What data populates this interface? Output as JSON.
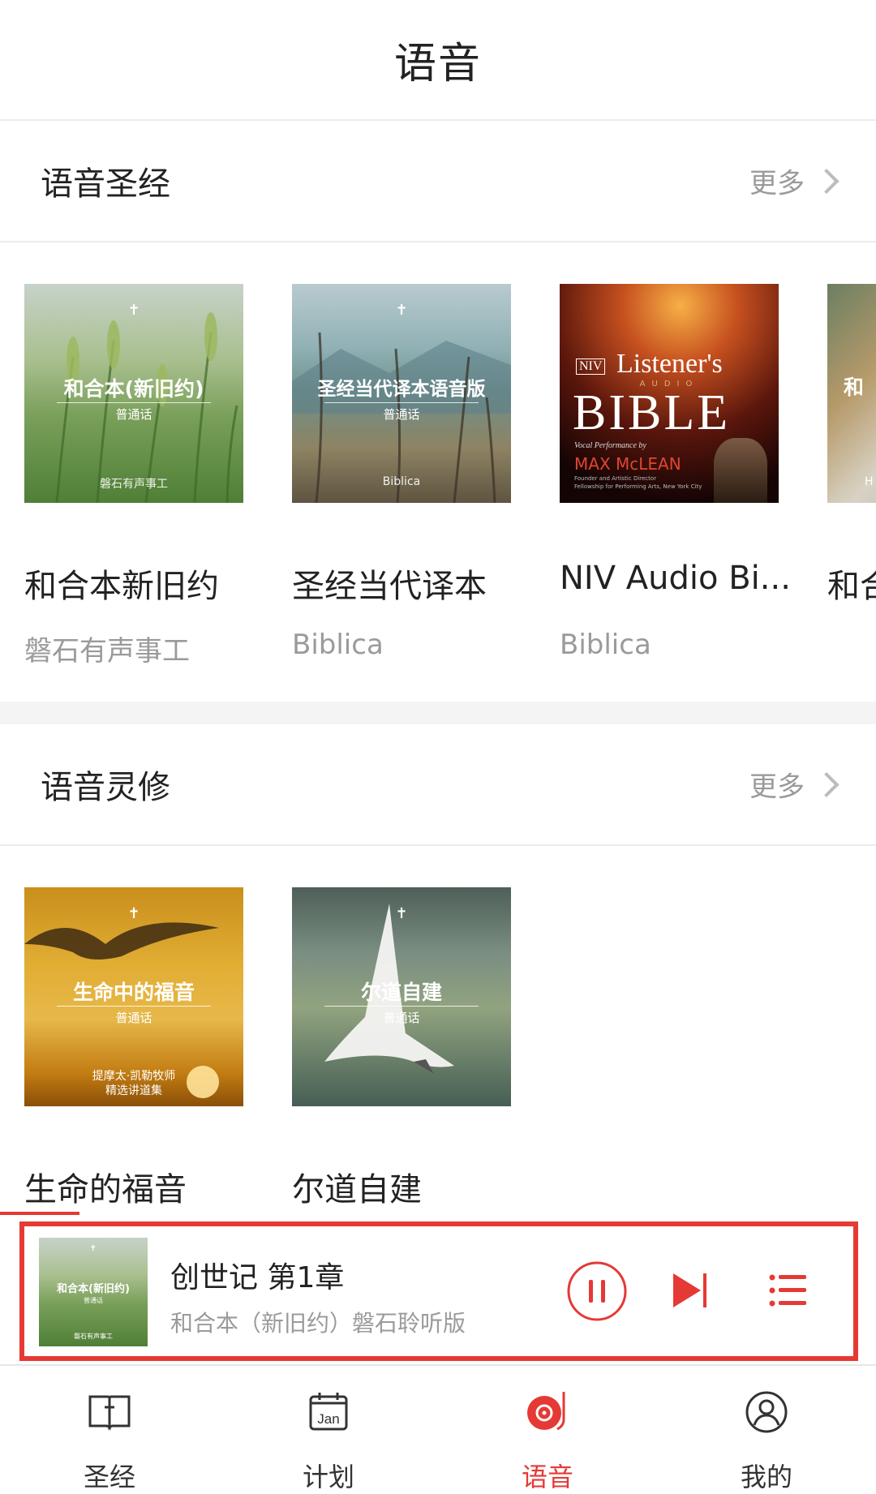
{
  "header": {
    "title": "语音"
  },
  "audio_bible": {
    "title": "语音圣经",
    "more_label": "更多",
    "items": [
      {
        "name": "和合本新旧约",
        "publisher": "磐石有声事工",
        "cover": {
          "title": "和合本(新旧约)",
          "dialect": "普通话",
          "footer": "磐石有声事工"
        }
      },
      {
        "name": "圣经当代译本",
        "publisher": "Biblica",
        "cover": {
          "title": "圣经当代译本语音版",
          "dialect": "普通话",
          "footer": "Biblica"
        }
      },
      {
        "name": "NIV Audio Bi...",
        "publisher": "Biblica",
        "cover": {
          "badge": "NIV",
          "title_top": "Listener's",
          "audio": "AUDIO",
          "title_main": "BIBLE",
          "vocal": "Vocal Performance by",
          "narrator": "MAX McLEAN",
          "credit1": "Founder and Artistic Director",
          "credit2": "Fellowship for Performing Arts, New York City"
        }
      },
      {
        "name": "和合",
        "publisher": "",
        "cover": {
          "title": "和",
          "footer": "H"
        }
      }
    ]
  },
  "devotional": {
    "title": "语音灵修",
    "more_label": "更多",
    "items": [
      {
        "name": "生命的福音",
        "cover": {
          "title": "生命中的福音",
          "dialect": "普通话",
          "footer1": "提摩太·凯勒牧师",
          "footer2": "精选讲道集"
        }
      },
      {
        "name": "尔道自建",
        "cover": {
          "title": "尔道自建",
          "dialect": "普通话"
        }
      }
    ]
  },
  "now_playing": {
    "title": "创世记 第1章",
    "subtitle": "和合本（新旧约）磐石聆听版",
    "thumb": {
      "title": "和合本(新旧约)",
      "dialect": "普通话",
      "footer": "磐石有声事工"
    }
  },
  "tabs": [
    {
      "label": "圣经",
      "icon": "bible-book-icon"
    },
    {
      "label": "计划",
      "icon": "calendar-icon",
      "icon_text": "Jan"
    },
    {
      "label": "语音",
      "icon": "record-player-icon",
      "active": true
    },
    {
      "label": "我的",
      "icon": "user-profile-icon"
    }
  ],
  "colors": {
    "accent": "#e53935",
    "muted": "#9a9a9a",
    "divider": "#ececec"
  }
}
